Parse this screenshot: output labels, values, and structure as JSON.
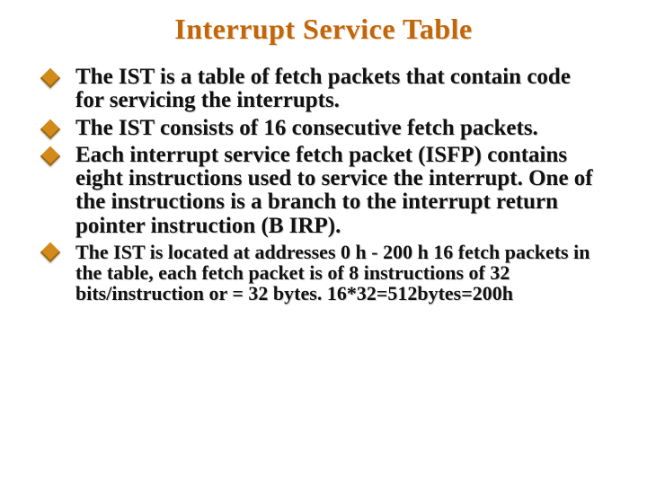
{
  "title": "Interrupt Service Table",
  "bullets": [
    {
      "text": "The IST is a table of fetch packets that contain code for servicing the interrupts."
    },
    {
      "text": "The IST consists of 16 consecutive fetch packets."
    },
    {
      "text": "Each interrupt service fetch packet (ISFP) contains eight instructions used to service the interrupt.  One of the instructions is a branch to the interrupt return pointer instruction (B IRP)."
    },
    {
      "text": "The IST is located at addresses 0 h - 200 h 16 fetch packets in the table, each fetch packet is of 8 instructions of 32 bits/instruction or = 32 bytes.  16*32=512bytes=200h"
    }
  ]
}
